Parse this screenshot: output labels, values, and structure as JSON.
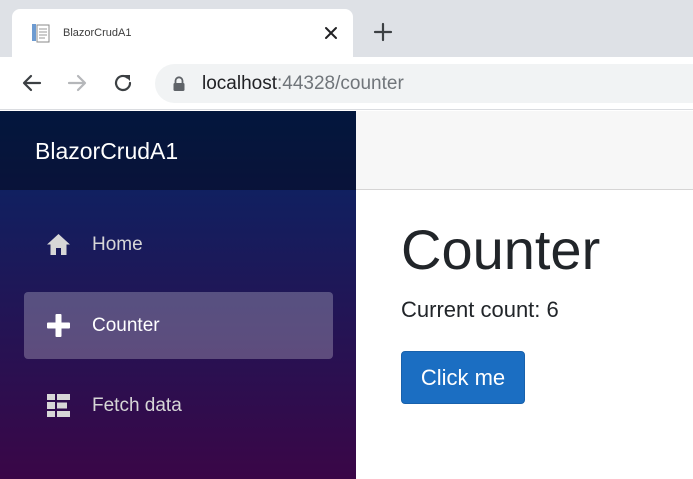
{
  "browser": {
    "tab": {
      "title": "BlazorCrudA1",
      "favicon": "document-icon"
    },
    "address_bar": {
      "host": "localhost",
      "rest": ":44328/counter"
    },
    "icons": {
      "back": "arrow-left-icon",
      "forward": "arrow-right-icon",
      "reload": "reload-icon",
      "lock": "lock-icon",
      "close": "close-icon",
      "new_tab": "plus-icon"
    }
  },
  "app": {
    "brand": "BlazorCrudA1",
    "nav": [
      {
        "label": "Home",
        "icon": "home-icon",
        "active": false
      },
      {
        "label": "Counter",
        "icon": "plus-icon",
        "active": true
      },
      {
        "label": "Fetch data",
        "icon": "list-icon",
        "active": false
      }
    ],
    "page": {
      "title": "Counter",
      "count_text": "Current count: 6",
      "button_label": "Click me"
    },
    "colors": {
      "sidebar_top": "#052767",
      "sidebar_bottom": "#3a0647",
      "primary_button": "#1b6ec2",
      "active_nav": "rgba(255,255,255,0.25)"
    }
  }
}
